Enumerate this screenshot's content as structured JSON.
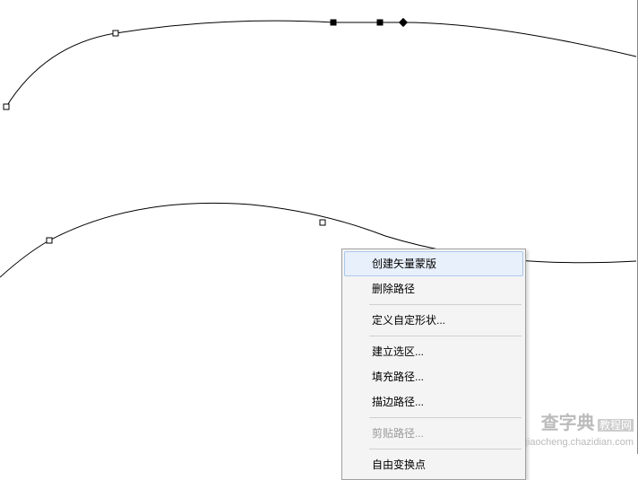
{
  "context_menu": {
    "items": [
      {
        "label": "创建矢量蒙版",
        "enabled": true,
        "highlighted": true
      },
      {
        "label": "删除路径",
        "enabled": true,
        "highlighted": false
      },
      {
        "separator": true
      },
      {
        "label": "定义自定形状...",
        "enabled": true,
        "highlighted": false
      },
      {
        "separator": true
      },
      {
        "label": "建立选区...",
        "enabled": true,
        "highlighted": false
      },
      {
        "label": "填充路径...",
        "enabled": true,
        "highlighted": false
      },
      {
        "label": "描边路径...",
        "enabled": true,
        "highlighted": false
      },
      {
        "separator": true
      },
      {
        "label": "剪贴路径...",
        "enabled": false,
        "highlighted": false
      },
      {
        "separator": true
      },
      {
        "label": "自由变换点",
        "enabled": true,
        "highlighted": false
      }
    ]
  },
  "watermark": {
    "brand": "查字典",
    "section": "教程网",
    "url": "jiaocheng.chazidian.com"
  }
}
